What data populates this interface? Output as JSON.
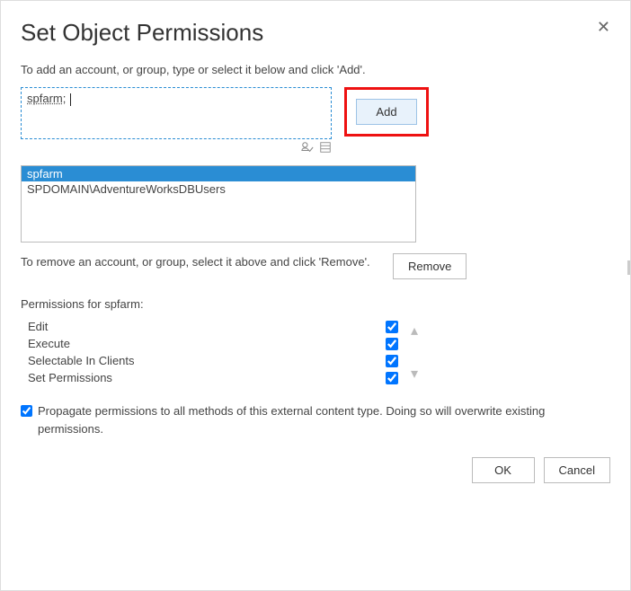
{
  "dialog": {
    "title": "Set Object Permissions",
    "close_symbol": "✕"
  },
  "add": {
    "instruction": "To add an account, or group, type or select it below and click 'Add'.",
    "input_value": "spfarm",
    "input_suffix": ";",
    "button_label": "Add"
  },
  "list": {
    "items": [
      {
        "label": "spfarm",
        "selected": true
      },
      {
        "label": "SPDOMAIN\\AdventureWorksDBUsers",
        "selected": false
      }
    ]
  },
  "remove": {
    "instruction": "To remove an account, or group, select it above and click 'Remove'.",
    "button_label": "Remove"
  },
  "permissions": {
    "for_prefix": "Permissions for ",
    "for_target": "spfarm",
    "for_suffix": ":",
    "rows": [
      {
        "label": "Edit",
        "checked": true
      },
      {
        "label": "Execute",
        "checked": true
      },
      {
        "label": "Selectable In Clients",
        "checked": true
      },
      {
        "label": "Set Permissions",
        "checked": true
      }
    ]
  },
  "propagate": {
    "checked": true,
    "label": "Propagate permissions to all methods of this external content type. Doing so will overwrite existing permissions."
  },
  "footer": {
    "ok": "OK",
    "cancel": "Cancel"
  },
  "icons": {
    "check_names": "🔍",
    "browse": "▭"
  },
  "scroll": {
    "up": "▴",
    "down": "▾"
  }
}
